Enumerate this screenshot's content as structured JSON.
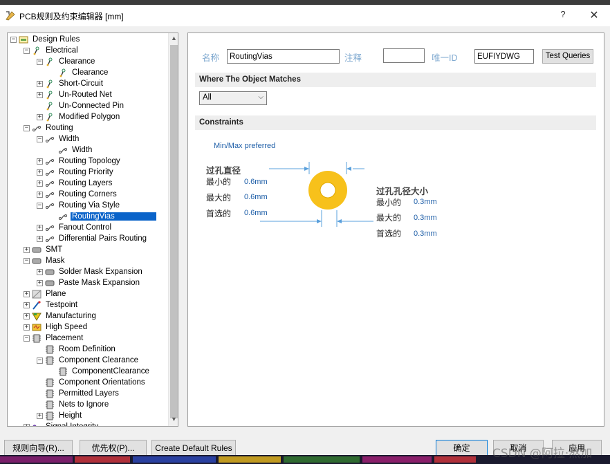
{
  "window": {
    "title": "PCB规则及约束编辑器 [mm]",
    "help": "?",
    "close": "✕"
  },
  "tree": {
    "items": [
      {
        "label": "Design Rules",
        "level": 0,
        "expander": "−",
        "icon": "design-rules-icon"
      },
      {
        "label": "Electrical",
        "level": 1,
        "expander": "−",
        "icon": "electrical-icon"
      },
      {
        "label": "Clearance",
        "level": 2,
        "expander": "−",
        "icon": "electrical-rule-icon"
      },
      {
        "label": "Clearance",
        "level": 3,
        "expander": "",
        "icon": "electrical-rule-icon"
      },
      {
        "label": "Short-Circuit",
        "level": 2,
        "expander": "+",
        "icon": "electrical-rule-icon"
      },
      {
        "label": "Un-Routed Net",
        "level": 2,
        "expander": "+",
        "icon": "electrical-rule-icon"
      },
      {
        "label": "Un-Connected Pin",
        "level": 2,
        "expander": "",
        "icon": "electrical-rule-icon"
      },
      {
        "label": "Modified Polygon",
        "level": 2,
        "expander": "+",
        "icon": "electrical-rule-icon"
      },
      {
        "label": "Routing",
        "level": 1,
        "expander": "−",
        "icon": "routing-icon"
      },
      {
        "label": "Width",
        "level": 2,
        "expander": "−",
        "icon": "routing-icon"
      },
      {
        "label": "Width",
        "level": 3,
        "expander": "",
        "icon": "routing-icon"
      },
      {
        "label": "Routing Topology",
        "level": 2,
        "expander": "+",
        "icon": "routing-icon"
      },
      {
        "label": "Routing Priority",
        "level": 2,
        "expander": "+",
        "icon": "routing-icon"
      },
      {
        "label": "Routing Layers",
        "level": 2,
        "expander": "+",
        "icon": "routing-icon"
      },
      {
        "label": "Routing Corners",
        "level": 2,
        "expander": "+",
        "icon": "routing-icon"
      },
      {
        "label": "Routing Via Style",
        "level": 2,
        "expander": "−",
        "icon": "routing-icon"
      },
      {
        "label": "RoutingVias",
        "level": 3,
        "expander": "",
        "icon": "routing-icon",
        "selected": true
      },
      {
        "label": "Fanout Control",
        "level": 2,
        "expander": "+",
        "icon": "routing-icon"
      },
      {
        "label": "Differential Pairs Routing",
        "level": 2,
        "expander": "+",
        "icon": "routing-icon"
      },
      {
        "label": "SMT",
        "level": 1,
        "expander": "+",
        "icon": "smt-icon"
      },
      {
        "label": "Mask",
        "level": 1,
        "expander": "−",
        "icon": "mask-icon"
      },
      {
        "label": "Solder Mask Expansion",
        "level": 2,
        "expander": "+",
        "icon": "mask-icon"
      },
      {
        "label": "Paste Mask Expansion",
        "level": 2,
        "expander": "+",
        "icon": "mask-icon"
      },
      {
        "label": "Plane",
        "level": 1,
        "expander": "+",
        "icon": "plane-icon"
      },
      {
        "label": "Testpoint",
        "level": 1,
        "expander": "+",
        "icon": "testpoint-icon"
      },
      {
        "label": "Manufacturing",
        "level": 1,
        "expander": "+",
        "icon": "manufacturing-icon"
      },
      {
        "label": "High Speed",
        "level": 1,
        "expander": "+",
        "icon": "high-speed-icon"
      },
      {
        "label": "Placement",
        "level": 1,
        "expander": "−",
        "icon": "placement-icon"
      },
      {
        "label": "Room Definition",
        "level": 2,
        "expander": "",
        "icon": "placement-icon"
      },
      {
        "label": "Component Clearance",
        "level": 2,
        "expander": "−",
        "icon": "placement-icon"
      },
      {
        "label": "ComponentClearance",
        "level": 3,
        "expander": "",
        "icon": "placement-icon"
      },
      {
        "label": "Component Orientations",
        "level": 2,
        "expander": "",
        "icon": "placement-icon"
      },
      {
        "label": "Permitted Layers",
        "level": 2,
        "expander": "",
        "icon": "placement-icon"
      },
      {
        "label": "Nets to Ignore",
        "level": 2,
        "expander": "",
        "icon": "placement-icon"
      },
      {
        "label": "Height",
        "level": 2,
        "expander": "+",
        "icon": "placement-icon"
      },
      {
        "label": "Signal Integrity",
        "level": 1,
        "expander": "+",
        "icon": "signal-integrity-icon"
      }
    ]
  },
  "rule": {
    "name_label": "名称",
    "name_value": "RoutingVias",
    "comment_label": "注释",
    "comment_value": "",
    "id_label": "唯一ID",
    "id_value": "EUFIYDWG",
    "test_queries": "Test Queries"
  },
  "match": {
    "header": "Where The Object Matches",
    "selected": "All"
  },
  "constraints": {
    "header": "Constraints",
    "mode": "Min/Max preferred",
    "via_diameter": {
      "title": "过孔直径",
      "min_label": "最小的",
      "min_value": "0.6mm",
      "max_label": "最大的",
      "max_value": "0.6mm",
      "pref_label": "首选的",
      "pref_value": "0.6mm"
    },
    "hole_size": {
      "title": "过孔孔径大小",
      "min_label": "最小的",
      "min_value": "0.3mm",
      "max_label": "最大的",
      "max_value": "0.3mm",
      "pref_label": "首选的",
      "pref_value": "0.3mm"
    },
    "colors": {
      "via_ring": "#f7c11b",
      "hole": "#ffffff",
      "dim_line": "#5aa0dc"
    }
  },
  "buttons": {
    "rule_wizard": "规则向导(R)...",
    "priorities": "优先权(P)...",
    "create_default": "Create Default Rules",
    "ok": "确定",
    "cancel": "取消",
    "apply": "应用"
  },
  "watermark": "CSDN @阿拉·熬加"
}
